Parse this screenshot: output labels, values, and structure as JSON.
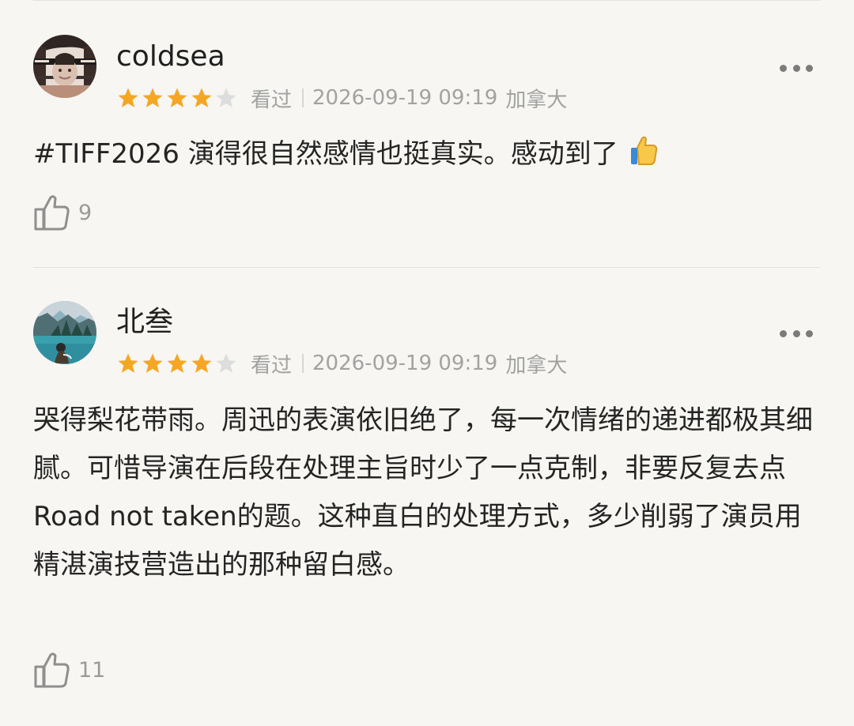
{
  "reviews": [
    {
      "username": "coldsea",
      "rating": 4,
      "status": "看过",
      "timestamp": "2026-09-19 09:19",
      "location": "加拿大",
      "content": "#TIFF2026 演得很自然感情也挺真实。感动到了",
      "likes": "9"
    },
    {
      "username": "北叁",
      "rating": 4,
      "status": "看过",
      "timestamp": "2026-09-19 09:19",
      "location": "加拿大",
      "content": "哭得梨花带雨。周迅的表演依旧绝了，每一次情绪的递进都极其细腻。可惜导演在后段在处理主旨时少了一点克制，非要反复去点Road not taken的题。这种直白的处理方式，多少削弱了演员用精湛演技营造出的那种留白感。",
      "likes": "11"
    }
  ],
  "colors": {
    "background": "#f7f6f3",
    "star_filled": "#f5a623",
    "star_empty": "#dddddd",
    "meta_text": "#a2a2a2"
  },
  "icons": [
    "more-icon",
    "star-icon",
    "thumbs-up-emoji",
    "like-icon"
  ]
}
